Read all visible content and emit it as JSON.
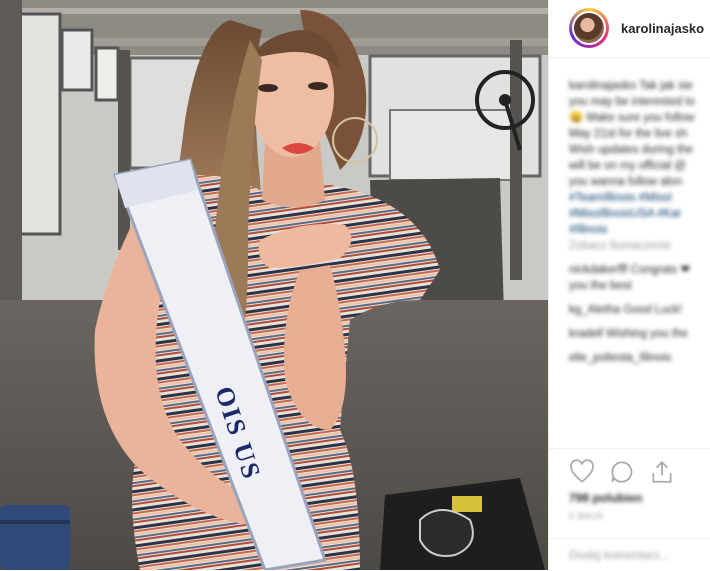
{
  "post": {
    "username": "karolinajasko",
    "sash_text": "OIS US",
    "caption_lines": [
      "karolinajasko Tak jak sie",
      "you may be interested to",
      "😀 Make sure you follow",
      "May 21st for the live sh",
      "Wish updates during the",
      "will be on my official @",
      "you wanna follow alon",
      "#TeamIllinois #MissI",
      "#MissIllinoisUSA #Kar",
      "#Illinois"
    ],
    "translate_label": "Zobacz tlumaczenie",
    "comments": [
      "nickdakerfff Congrats ❤",
      "you the best",
      "kg_Aletha Good Luck!",
      "kradell Wishing you the",
      "elie_poliesta_Illinois"
    ],
    "likes_text": "798 polubien",
    "date_text": "5 MAJA",
    "comment_placeholder": "Dodaj komentarz..."
  },
  "icons": [
    "heart-icon",
    "comment-icon",
    "share-icon"
  ],
  "colors": {
    "text": "#262626",
    "link": "#003569",
    "muted": "#999999",
    "border": "#efefef"
  }
}
